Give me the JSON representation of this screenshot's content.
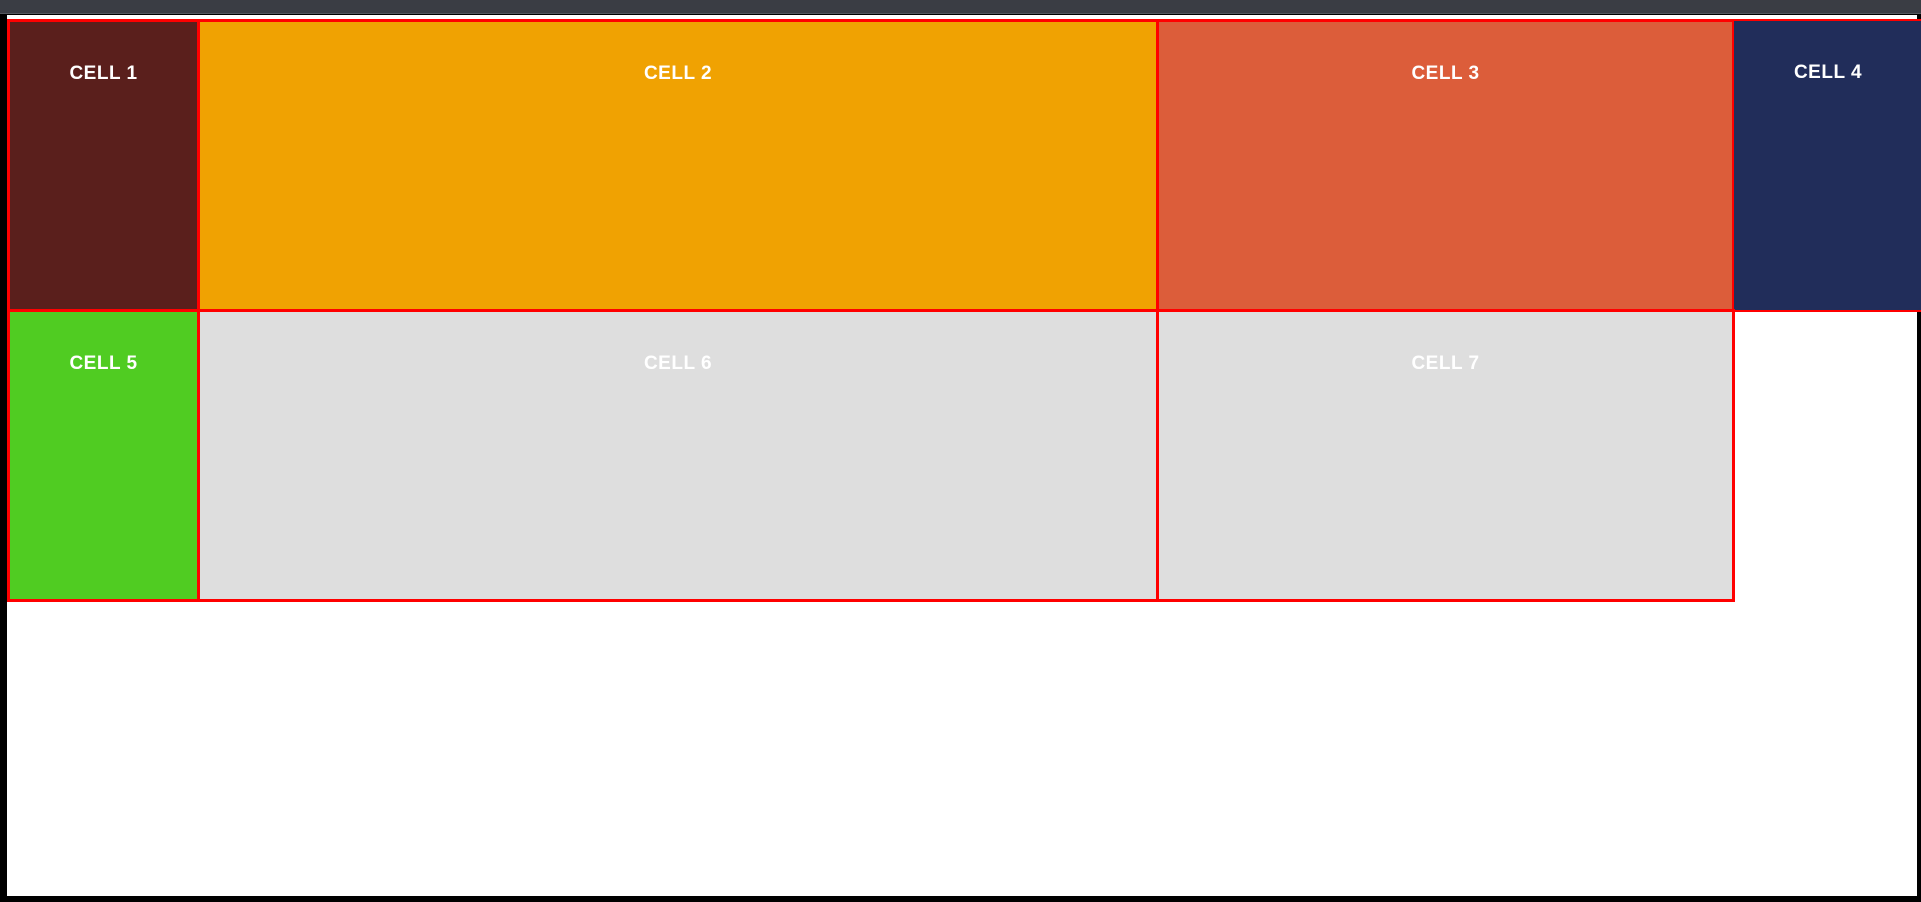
{
  "cells": [
    {
      "label": "CELL 1",
      "color": "#5a1f1c"
    },
    {
      "label": "CELL 2",
      "color": "#f0a202"
    },
    {
      "label": "CELL 3",
      "color": "#dc5d3a"
    },
    {
      "label": "CELL 4",
      "color": "#212d5a"
    },
    {
      "label": "CELL 5",
      "color": "#50cc22"
    },
    {
      "label": "CELL 6",
      "color": "#dedede"
    },
    {
      "label": "CELL 7",
      "color": "#dedede"
    }
  ],
  "colors": {
    "border": "#ff0000",
    "frame": "#000000",
    "topbar": "#3a3d44",
    "page": "#ffffff"
  }
}
